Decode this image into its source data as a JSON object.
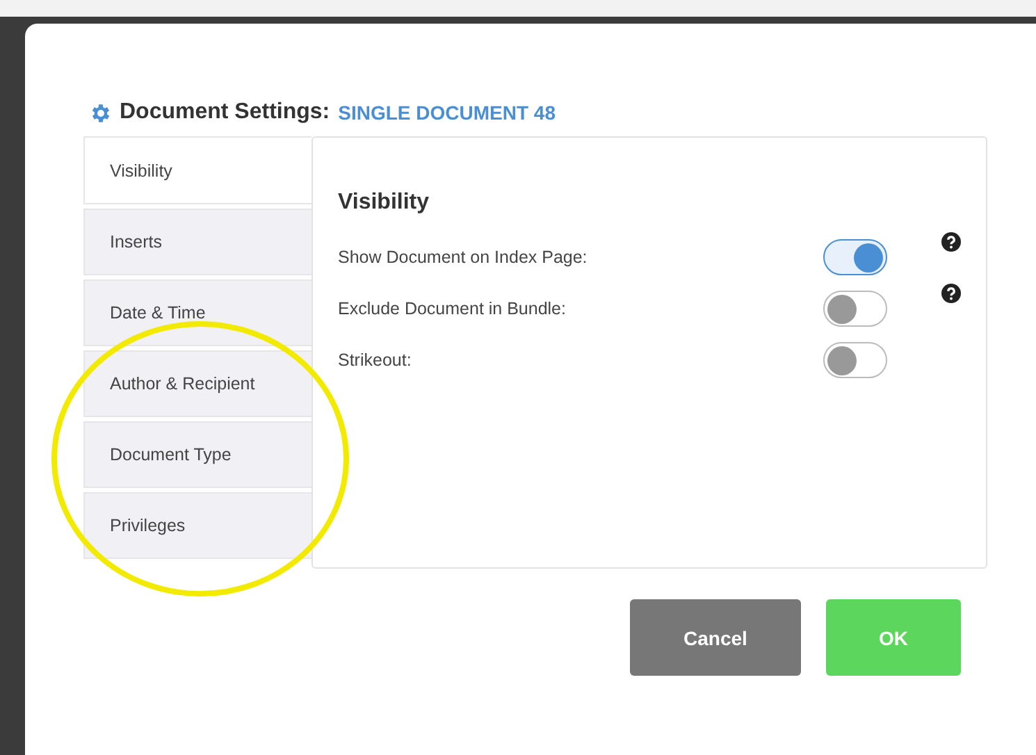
{
  "dialog": {
    "title": "Document Settings:",
    "subtitle": "SINGLE DOCUMENT 48"
  },
  "tabs": [
    {
      "label": "Visibility",
      "selected": true
    },
    {
      "label": "Inserts",
      "selected": false
    },
    {
      "label": "Date & Time",
      "selected": false
    },
    {
      "label": "Author & Recipient",
      "selected": false
    },
    {
      "label": "Document Type",
      "selected": false
    },
    {
      "label": "Privileges",
      "selected": false
    }
  ],
  "panel": {
    "heading": "Visibility",
    "settings": [
      {
        "label": "Show Document on Index Page:",
        "on": true,
        "help": true
      },
      {
        "label": "Exclude Document in Bundle:",
        "on": false,
        "help": true
      },
      {
        "label": "Strikeout:",
        "on": false,
        "help": false
      }
    ]
  },
  "buttons": [
    {
      "label": "Cancel",
      "kind": "secondary"
    },
    {
      "label": "OK",
      "kind": "primary"
    }
  ]
}
